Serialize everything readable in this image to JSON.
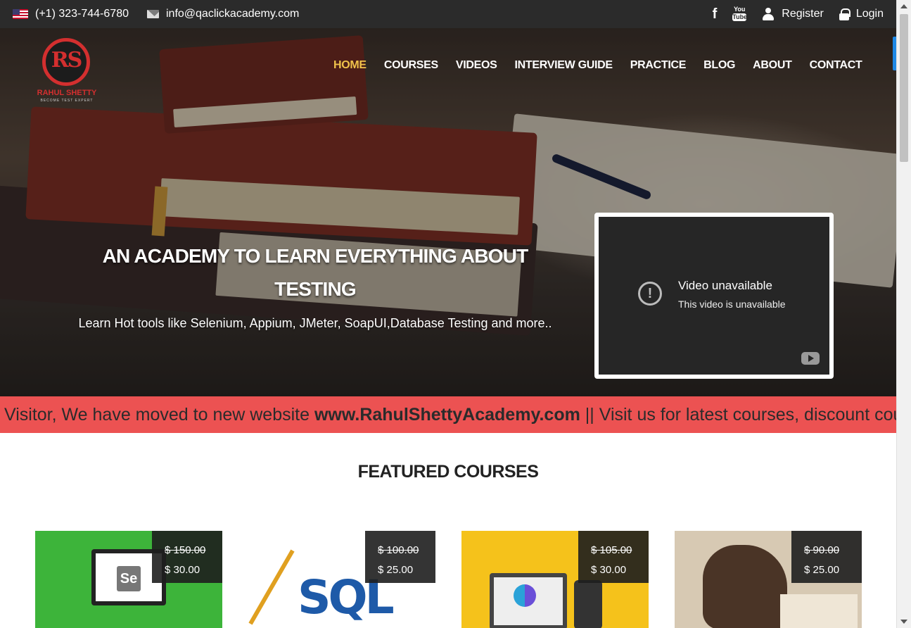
{
  "topbar": {
    "phone": "(+1) 323-744-6780",
    "email": "info@qaclickacademy.com",
    "facebook_glyph": "f",
    "youtube_top": "You",
    "youtube_bottom": "Tube",
    "register": "Register",
    "login": "Login"
  },
  "logo": {
    "initials": "RS",
    "name": "RAHUL SHETTY",
    "tagline": "BECOME TEST EXPERT"
  },
  "nav": {
    "items": [
      {
        "label": "HOME",
        "active": true
      },
      {
        "label": "COURSES"
      },
      {
        "label": "VIDEOS"
      },
      {
        "label": "INTERVIEW GUIDE"
      },
      {
        "label": "PRACTICE"
      },
      {
        "label": "BLOG"
      },
      {
        "label": "ABOUT"
      },
      {
        "label": "CONTACT"
      }
    ]
  },
  "hero": {
    "title": "AN ACADEMY TO LEARN EVERYTHING ABOUT TESTING",
    "subtitle": "Learn Hot tools like Selenium, Appium, JMeter, SoapUI,Database Testing and more.."
  },
  "video": {
    "title": "Video unavailable",
    "message": "This video is unavailable",
    "warning_glyph": "!"
  },
  "marquee": {
    "prefix": "Visitor, We have moved to new website ",
    "site": "www.RahulShettyAcademy.com",
    "suffix": " || Visit us for latest courses, discount coupons"
  },
  "featured": {
    "title": "FEATURED COURSES",
    "courses": [
      {
        "old_price": "$ 150.00",
        "price": "$ 30.00",
        "image_text": "Se"
      },
      {
        "old_price": "$ 100.00",
        "price": "$ 25.00",
        "image_text": "SQL"
      },
      {
        "old_price": "$ 105.00",
        "price": "$ 30.00"
      },
      {
        "old_price": "$ 90.00",
        "price": "$ 25.00"
      }
    ]
  },
  "colors": {
    "accent_active": "#f0c24b",
    "marquee_bg": "#ec5252",
    "topbar_bg": "#2b2b2b"
  }
}
